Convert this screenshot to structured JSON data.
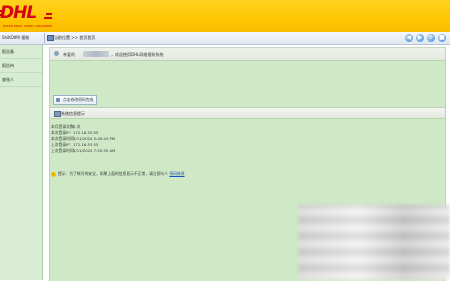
{
  "header": {
    "logo_text": "DHL",
    "logo_sub": "EXCELLENCE. SIMPLY DELIVERED."
  },
  "nav": {
    "system_label": "ShiKOtMI 报账",
    "current_page": "当前位置 >> 首页首页",
    "buttons": [
      "◀",
      "▶",
      "⟳",
      "■"
    ]
  },
  "sidebar": {
    "items": [
      {
        "label": "报告备"
      },
      {
        "label": "报告待"
      },
      {
        "label": "查账人"
      }
    ]
  },
  "welcome": {
    "prefix": "亲爱的",
    "suffix": "，欢迎使用DHL网络报账系统"
  },
  "change_password_button": "点击修改密码完成",
  "info_panel": {
    "title": "系统信息提示",
    "rows": [
      {
        "key": "本月登录次数：",
        "value": "0 次"
      },
      {
        "key": "本次登录IP：",
        "value": "172.16.53.55"
      },
      {
        "key": "本次登录时间：",
        "value": "7/11/2024 5:40:43 PM"
      },
      {
        "key": "上次登录IP：",
        "value": "172.16.53.55"
      },
      {
        "key": "上次登录时间：",
        "value": "7/11/2024 7:55:35 AM"
      }
    ]
  },
  "tip": {
    "icon": "!",
    "text": "提示：为了帐号的安全，如果上面的信息显示不正常，请立即与人",
    "link": "密码修改"
  },
  "colors": {
    "brand_yellow": "#ffcc00",
    "brand_red": "#d40511",
    "panel_green": "#cfe8c6",
    "sidebar_green": "#d7ecd2"
  }
}
